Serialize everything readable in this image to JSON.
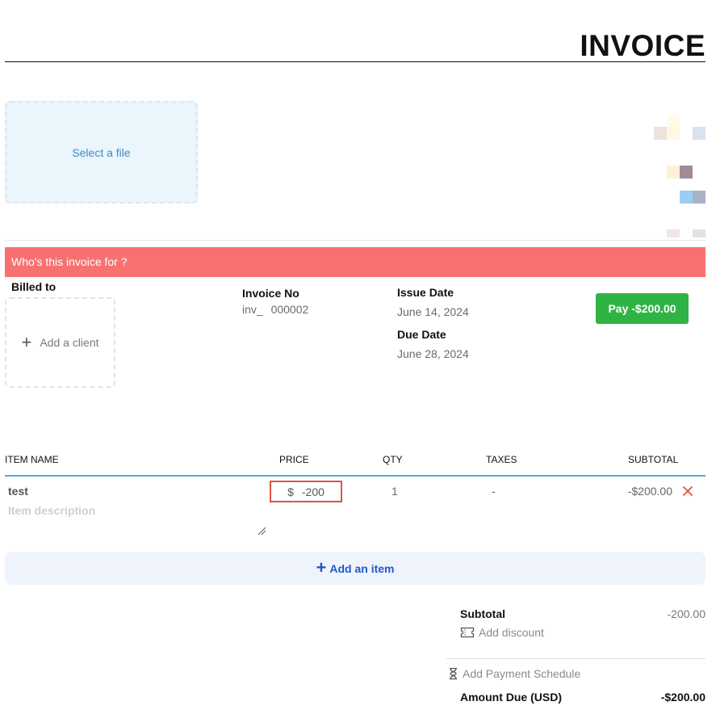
{
  "header": {
    "title": "INVOICE"
  },
  "upload": {
    "label": "Select a file"
  },
  "banner": {
    "text": "Who's this invoice for ?"
  },
  "billing": {
    "billed_to_label": "Billed to",
    "add_client_label": "Add a client",
    "invoice_no_label": "Invoice No",
    "invoice_prefix": "inv_",
    "invoice_number": "000002",
    "issue_date_label": "Issue Date",
    "issue_date": "June 14, 2024",
    "due_date_label": "Due Date",
    "due_date": "June 28, 2024",
    "pay_button": "Pay -$200.00"
  },
  "table": {
    "headers": {
      "item": "ITEM NAME",
      "price": "PRICE",
      "qty": "QTY",
      "taxes": "TAXES",
      "subtotal": "SUBTOTAL"
    },
    "rows": [
      {
        "name": "test",
        "description_placeholder": "Item description",
        "currency": "$",
        "price": "-200",
        "qty": "1",
        "taxes": "-",
        "subtotal": "-$200.00"
      }
    ],
    "add_item_label": "Add an item"
  },
  "summary": {
    "subtotal_label": "Subtotal",
    "subtotal_value": "-200.00",
    "add_discount_label": "Add discount",
    "add_schedule_label": "Add Payment Schedule",
    "amount_due_label": "Amount Due (USD)",
    "amount_due_value": "-$200.00"
  },
  "colors": {
    "banner": "#f87171",
    "pay_button": "#2fb344",
    "accent_link": "#1f59c7",
    "table_rule": "#58a6dc",
    "highlight_border": "#e15241"
  }
}
